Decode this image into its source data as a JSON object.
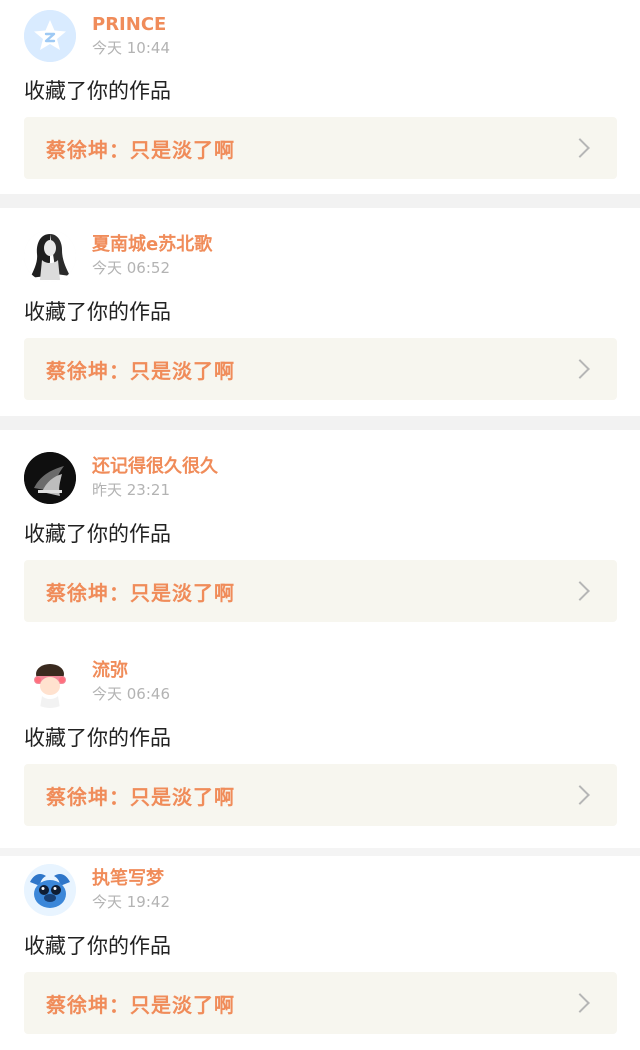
{
  "items": [
    {
      "user": "PRINCE",
      "time": "今天 10:44",
      "action": "收藏了你的作品",
      "work_title": "蔡徐坤：只是淡了啊",
      "avatar_icon": "qzone-star-icon",
      "avatar_bg": "#d9ebff"
    },
    {
      "user": "夏南城e苏北歌",
      "time": "今天 06:52",
      "action": "收藏了你的作品",
      "work_title": "蔡徐坤：只是淡了啊",
      "avatar_icon": "sketch-girl-icon",
      "avatar_bg": "#f6f6f6"
    },
    {
      "user": "还记得很久很久",
      "time": "昨天 23:21",
      "action": "收藏了你的作品",
      "work_title": "蔡徐坤：只是淡了啊",
      "avatar_icon": "dark-couple-icon",
      "avatar_bg": "#0f0f0f"
    },
    {
      "user": "流弥",
      "time": "今天 06:46",
      "action": "收藏了你的作品",
      "work_title": "蔡徐坤：只是淡了啊",
      "avatar_icon": "cartoon-girl-icon",
      "avatar_bg": "#ffffff"
    },
    {
      "user": "执笔写梦",
      "time": "今天 19:42",
      "action": "收藏了你的作品",
      "work_title": "蔡徐坤：只是淡了啊",
      "avatar_icon": "stitch-character-icon",
      "avatar_bg": "#e8f4ff"
    }
  ],
  "colors": {
    "username": "#f08c5a",
    "work_title": "#f08c5a",
    "time": "#b3b3b3",
    "work_bg": "#f7f6ef"
  }
}
